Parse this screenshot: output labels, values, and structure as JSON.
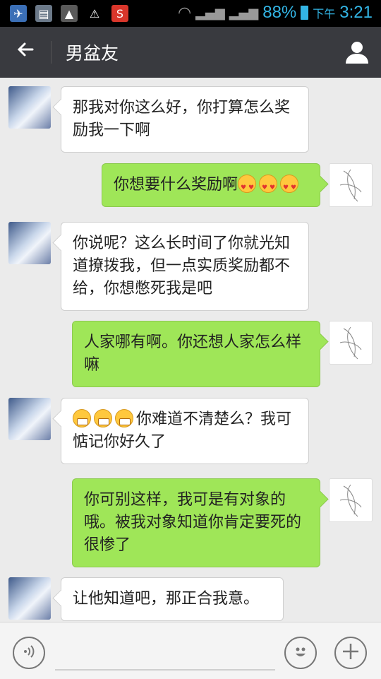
{
  "status_bar": {
    "battery": "88%",
    "period": "下午",
    "time": "3:21",
    "icons": [
      "notification-bird-icon",
      "sim-icon",
      "image-icon",
      "warning-icon",
      "sogou-icon",
      "wifi-icon",
      "signal-x-icon",
      "signal-icon",
      "battery-icon"
    ]
  },
  "header": {
    "title": "男盆友",
    "back_icon": "arrow-left-icon",
    "profile_icon": "person-icon"
  },
  "messages": [
    {
      "side": "left",
      "text": "那我对你这么好，你打算怎么奖励我一下啊",
      "emoji_before": ""
    },
    {
      "side": "right",
      "text": "你想要什么奖励啊",
      "emoji_after": "heart-eyes-icon x3"
    },
    {
      "side": "left",
      "text": "你说呢？这么长时间了你就光知道撩拨我，但一点实质奖励都不给，你想憋死我是吧"
    },
    {
      "side": "right",
      "text": "人家哪有啊。你还想人家怎么样嘛"
    },
    {
      "side": "left",
      "text": "你难道不清楚么？我可惦记你好久了",
      "emoji_before": "grimace-icon x3"
    },
    {
      "side": "right",
      "text": "你可别这样，我可是有对象的哦。被我对象知道你肯定要死的很惨了"
    },
    {
      "side": "left",
      "text": "让他知道吧，那正合我意。"
    }
  ],
  "input_bar": {
    "voice_icon": "voice-icon",
    "emoji_icon": "smiley-icon",
    "plus_icon": "plus-icon"
  },
  "colors": {
    "titlebar": "#393a3f",
    "background": "#ebebeb",
    "bubble_sent": "#9fe658",
    "bubble_received": "#ffffff",
    "status_accent": "#33b5e5"
  }
}
